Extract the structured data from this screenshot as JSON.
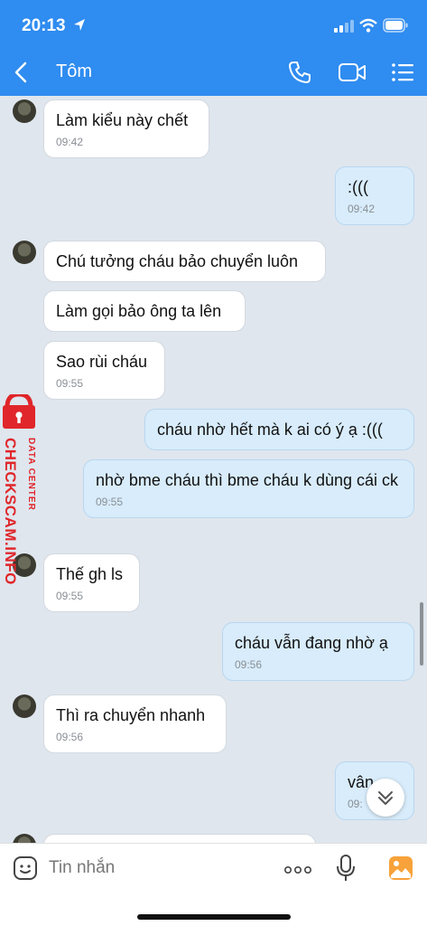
{
  "status": {
    "time": "20:13"
  },
  "header": {
    "contact_name": "Tôm"
  },
  "watermark": {
    "line1": "DATA CENTER",
    "line2": "CHECKSCAM.INFO"
  },
  "messages": [
    {
      "text": "Làm kiểu này chết",
      "time": "09:42"
    },
    {
      "text": ":(((",
      "time": "09:42"
    },
    {
      "text": "Chú tưởng cháu bảo chuyển luôn"
    },
    {
      "text": "Làm gọi bảo ông ta lên"
    },
    {
      "text": "Sao rùi cháu",
      "time": "09:55"
    },
    {
      "text": "cháu nhờ hết mà k ai có ý ạ :((("
    },
    {
      "text": "nhờ bme cháu thì bme cháu k dùng cái ck",
      "time": "09:55"
    },
    {
      "text": "Thế gh ls",
      "time": "09:55"
    },
    {
      "text": "cháu vẫn đang nhờ ạ",
      "time": "09:56"
    },
    {
      "text": "Thì ra chuyển nhanh",
      "time": "09:56"
    },
    {
      "text": "vân",
      "time": "09:"
    }
  ],
  "input": {
    "placeholder": "Tin nhắn"
  },
  "colors": {
    "header": "#2f8cf0",
    "incoming_bubble": "#ffffff",
    "outgoing_bubble": "#d8ecfb",
    "chat_background": "#dfe6ee"
  }
}
